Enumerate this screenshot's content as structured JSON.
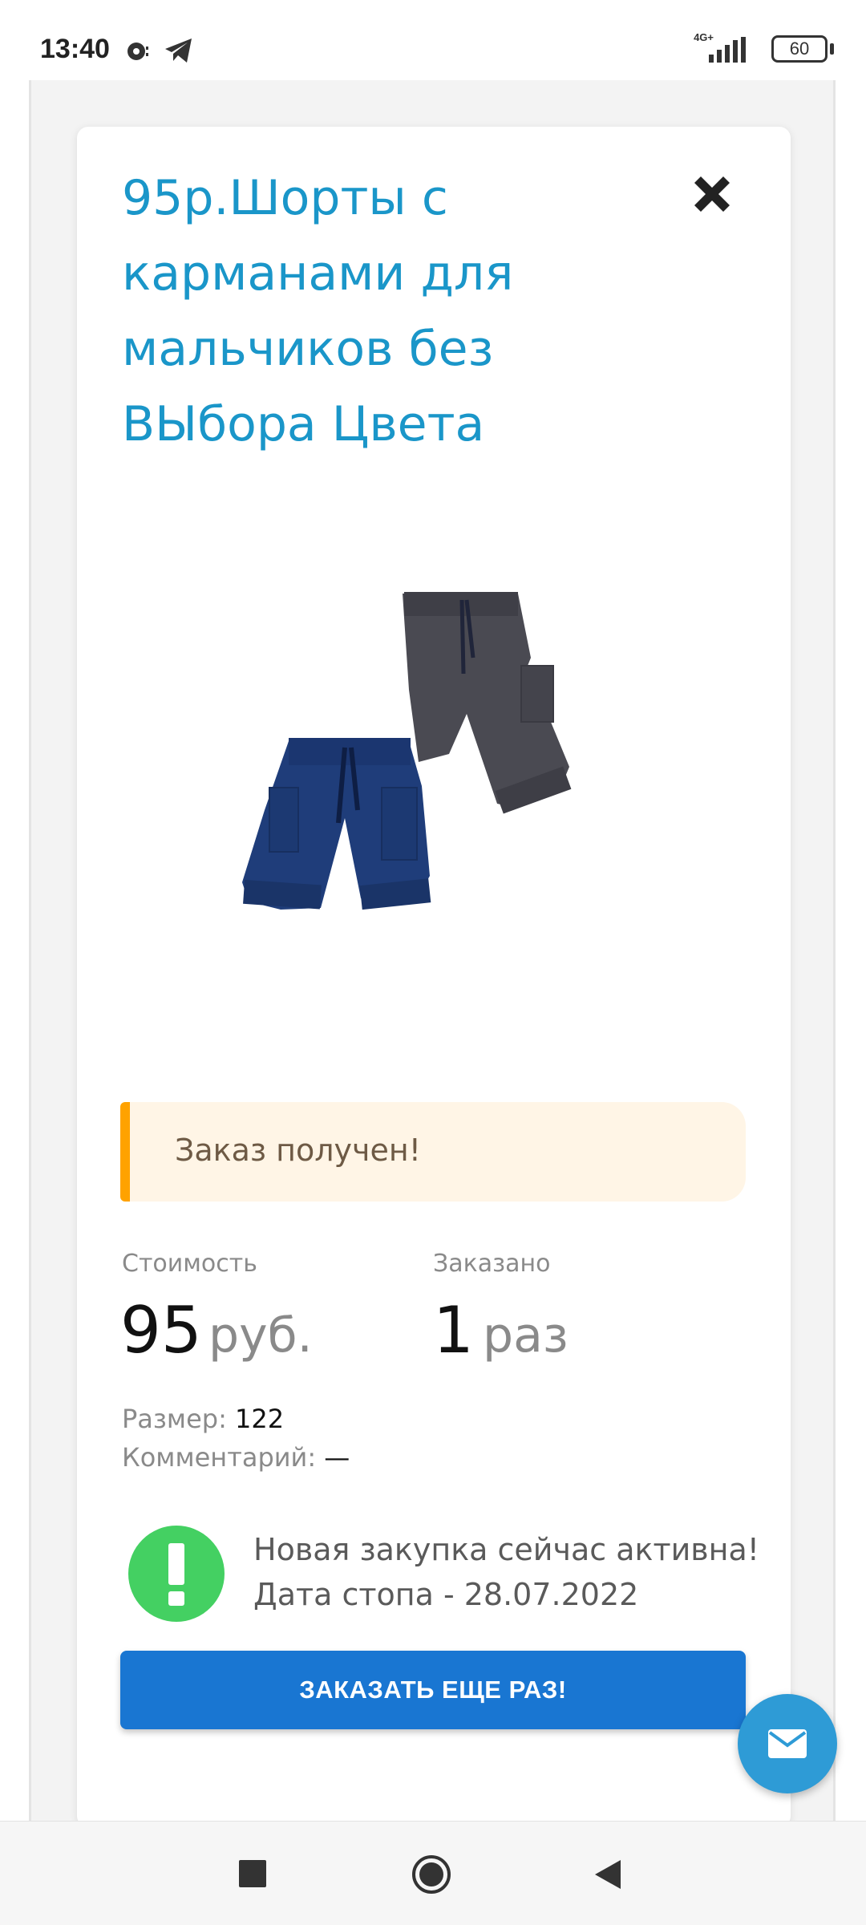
{
  "status_bar": {
    "time": "13:40",
    "network": "4G+",
    "battery": "60"
  },
  "product": {
    "title": "95р.Шорты с карманами для мальчиков без ВЫбора Цвета",
    "image_icon": "shorts-image",
    "colors": {
      "title": "#1a96c9",
      "navy_shorts": "#1f3d7a",
      "grey_shorts": "#4a4a52"
    }
  },
  "alert": {
    "text": "Заказ получен!",
    "accent": "#ffa200"
  },
  "price": {
    "label": "Стоимость",
    "value": "95",
    "unit": "руб."
  },
  "ordered": {
    "label": "Заказано",
    "value": "1",
    "unit": "раз"
  },
  "details": {
    "size_label": "Размер:",
    "size_value": "122",
    "comment_label": "Комментарий:",
    "comment_value": "—"
  },
  "notice": {
    "line1": "Новая закупка сейчас активна!",
    "line2": "Дата стопа - 28.07.2022",
    "icon": "exclamation-icon"
  },
  "actions": {
    "order_again": "ЗАКАЗАТЬ ЕЩЕ РАЗ!",
    "button_color": "#1976d2",
    "fab_icon": "mail-icon"
  },
  "nav": {
    "recent_icon": "square-icon",
    "home_icon": "circle-icon",
    "back_icon": "triangle-back-icon"
  }
}
